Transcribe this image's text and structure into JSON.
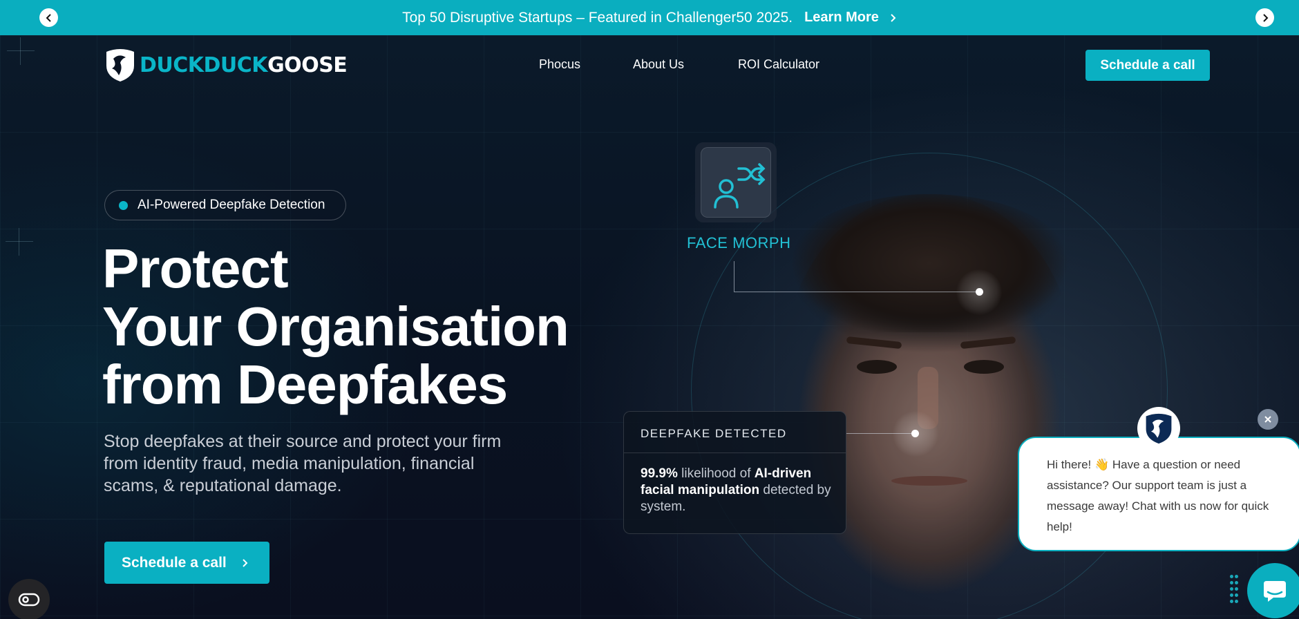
{
  "banner": {
    "text": "Top 50 Disruptive Startups – Featured in Challenger50 2025.",
    "link_label": "Learn More"
  },
  "brand": {
    "name_part1": "DUCKDUCK",
    "name_part2": "GOOSE",
    "accent_color": "#0ab0c2",
    "background_color": "#0a0f1f"
  },
  "nav": {
    "items": [
      {
        "label": "Phocus"
      },
      {
        "label": "About Us"
      },
      {
        "label": "ROI Calculator"
      }
    ],
    "cta_label": "Schedule a call"
  },
  "hero": {
    "pill_label": "AI-Powered Deepfake Detection",
    "headline_lines": [
      "Protect",
      "Your Organisation",
      "from Deepfakes"
    ],
    "subtext": "Stop deepfakes at their source and protect your firm from identity fraud, media manipulation, financial scams, & reputational damage.",
    "cta_label": "Schedule a call"
  },
  "face_morph": {
    "label": "FACE MORPH",
    "icon": "user-shuffle-icon"
  },
  "deepfake_card": {
    "title": "DEEPFAKE DETECTED",
    "percent": "99.9%",
    "text_1": " likelihood of ",
    "emphasis": "AI-driven facial manipulation",
    "text_2": " detected by system."
  },
  "chat": {
    "message": "Hi there! 👋 Have a question or need assistance? Our support team is just a message away! Chat with us now for quick help!"
  }
}
